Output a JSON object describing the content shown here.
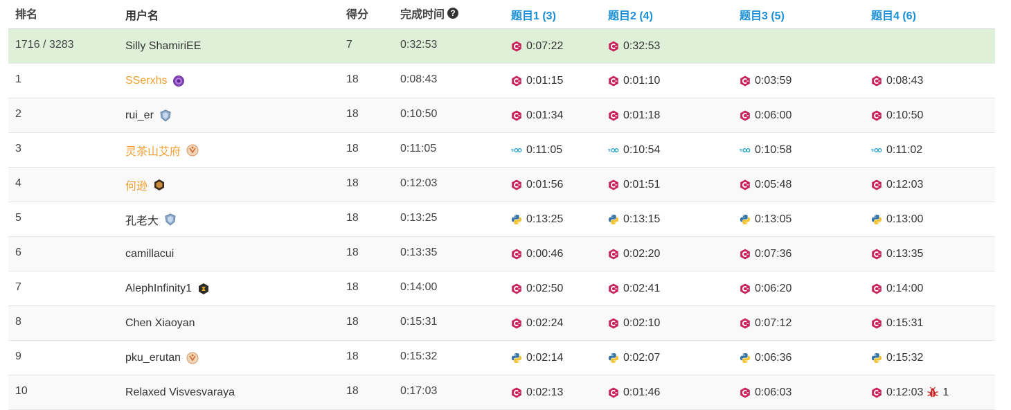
{
  "header": {
    "rank": "排名",
    "username": "用户名",
    "score": "得分",
    "finish_time": "完成时间",
    "problems": [
      "题目1 (3)",
      "题目2 (4)",
      "题目3 (5)",
      "题目4 (6)"
    ]
  },
  "colors": {
    "accent": "#1a8fd6",
    "self_row_bg": "#dff0d8",
    "username_highlight": "#f0a030",
    "cpp_icon": "#c8245a",
    "go_icon": "#29a4c4",
    "python_blue": "#3572a5",
    "python_yellow": "#f2c432",
    "bug_icon": "#c62828"
  },
  "rows": [
    {
      "rank": "1716 / 3283",
      "user": "Silly ShamiriEE",
      "user_style": "normal",
      "badge": "",
      "score": "7",
      "time": "0:32:53",
      "p": [
        {
          "lang": "cpp",
          "t": "0:07:22"
        },
        {
          "lang": "cpp",
          "t": "0:32:53"
        },
        null,
        null
      ],
      "self": true
    },
    {
      "rank": "1",
      "user": "SSerxhs",
      "user_style": "orange",
      "badge": "purple-medal-icon",
      "score": "18",
      "time": "0:08:43",
      "p": [
        {
          "lang": "cpp",
          "t": "0:01:15"
        },
        {
          "lang": "cpp",
          "t": "0:01:10"
        },
        {
          "lang": "cpp",
          "t": "0:03:59"
        },
        {
          "lang": "cpp",
          "t": "0:08:43"
        }
      ]
    },
    {
      "rank": "2",
      "user": "rui_er",
      "user_style": "normal",
      "badge": "shield-badge-icon",
      "score": "18",
      "time": "0:10:50",
      "p": [
        {
          "lang": "cpp",
          "t": "0:01:34"
        },
        {
          "lang": "cpp",
          "t": "0:01:18"
        },
        {
          "lang": "cpp",
          "t": "0:06:00"
        },
        {
          "lang": "cpp",
          "t": "0:10:50"
        }
      ]
    },
    {
      "rank": "3",
      "user": "灵茶山艾府",
      "user_style": "orange",
      "badge": "guardian-badge-icon",
      "score": "18",
      "time": "0:11:05",
      "p": [
        {
          "lang": "go",
          "t": "0:11:05"
        },
        {
          "lang": "go",
          "t": "0:10:54"
        },
        {
          "lang": "go",
          "t": "0:10:58"
        },
        {
          "lang": "go",
          "t": "0:11:02"
        }
      ]
    },
    {
      "rank": "4",
      "user": "何逊",
      "user_style": "orange",
      "badge": "hexagon-badge-icon",
      "score": "18",
      "time": "0:12:03",
      "p": [
        {
          "lang": "cpp",
          "t": "0:01:56"
        },
        {
          "lang": "cpp",
          "t": "0:01:51"
        },
        {
          "lang": "cpp",
          "t": "0:05:48"
        },
        {
          "lang": "cpp",
          "t": "0:12:03"
        }
      ]
    },
    {
      "rank": "5",
      "user": "孔老大",
      "user_style": "normal",
      "badge": "shield-badge-icon",
      "score": "18",
      "time": "0:13:25",
      "p": [
        {
          "lang": "py",
          "t": "0:13:25"
        },
        {
          "lang": "py",
          "t": "0:13:15"
        },
        {
          "lang": "py",
          "t": "0:13:05"
        },
        {
          "lang": "py",
          "t": "0:13:00"
        }
      ]
    },
    {
      "rank": "6",
      "user": "camillacui",
      "user_style": "normal",
      "badge": "",
      "score": "18",
      "time": "0:13:35",
      "p": [
        {
          "lang": "cpp",
          "t": "0:00:46"
        },
        {
          "lang": "cpp",
          "t": "0:02:20"
        },
        {
          "lang": "cpp",
          "t": "0:07:36"
        },
        {
          "lang": "cpp",
          "t": "0:13:35"
        }
      ]
    },
    {
      "rank": "7",
      "user": "AlephInfinity1",
      "user_style": "normal",
      "badge": "dark-hexagon-badge-icon",
      "score": "18",
      "time": "0:14:00",
      "p": [
        {
          "lang": "cpp",
          "t": "0:02:50"
        },
        {
          "lang": "cpp",
          "t": "0:02:41"
        },
        {
          "lang": "cpp",
          "t": "0:06:20"
        },
        {
          "lang": "cpp",
          "t": "0:14:00"
        }
      ]
    },
    {
      "rank": "8",
      "user": "Chen Xiaoyan",
      "user_style": "normal",
      "badge": "",
      "score": "18",
      "time": "0:15:31",
      "p": [
        {
          "lang": "cpp",
          "t": "0:02:24"
        },
        {
          "lang": "cpp",
          "t": "0:02:10"
        },
        {
          "lang": "cpp",
          "t": "0:07:12"
        },
        {
          "lang": "cpp",
          "t": "0:15:31"
        }
      ]
    },
    {
      "rank": "9",
      "user": "pku_erutan",
      "user_style": "normal",
      "badge": "guardian-badge-icon",
      "score": "18",
      "time": "0:15:32",
      "p": [
        {
          "lang": "py",
          "t": "0:02:14"
        },
        {
          "lang": "py",
          "t": "0:02:07"
        },
        {
          "lang": "py",
          "t": "0:06:36"
        },
        {
          "lang": "py",
          "t": "0:15:32"
        }
      ]
    },
    {
      "rank": "10",
      "user": "Relaxed Visvesvaraya",
      "user_style": "normal",
      "badge": "",
      "score": "18",
      "time": "0:17:03",
      "p": [
        {
          "lang": "cpp",
          "t": "0:02:13"
        },
        {
          "lang": "cpp",
          "t": "0:01:46"
        },
        {
          "lang": "cpp",
          "t": "0:06:03"
        },
        {
          "lang": "cpp",
          "t": "0:12:03",
          "bugs": "1"
        }
      ]
    }
  ]
}
